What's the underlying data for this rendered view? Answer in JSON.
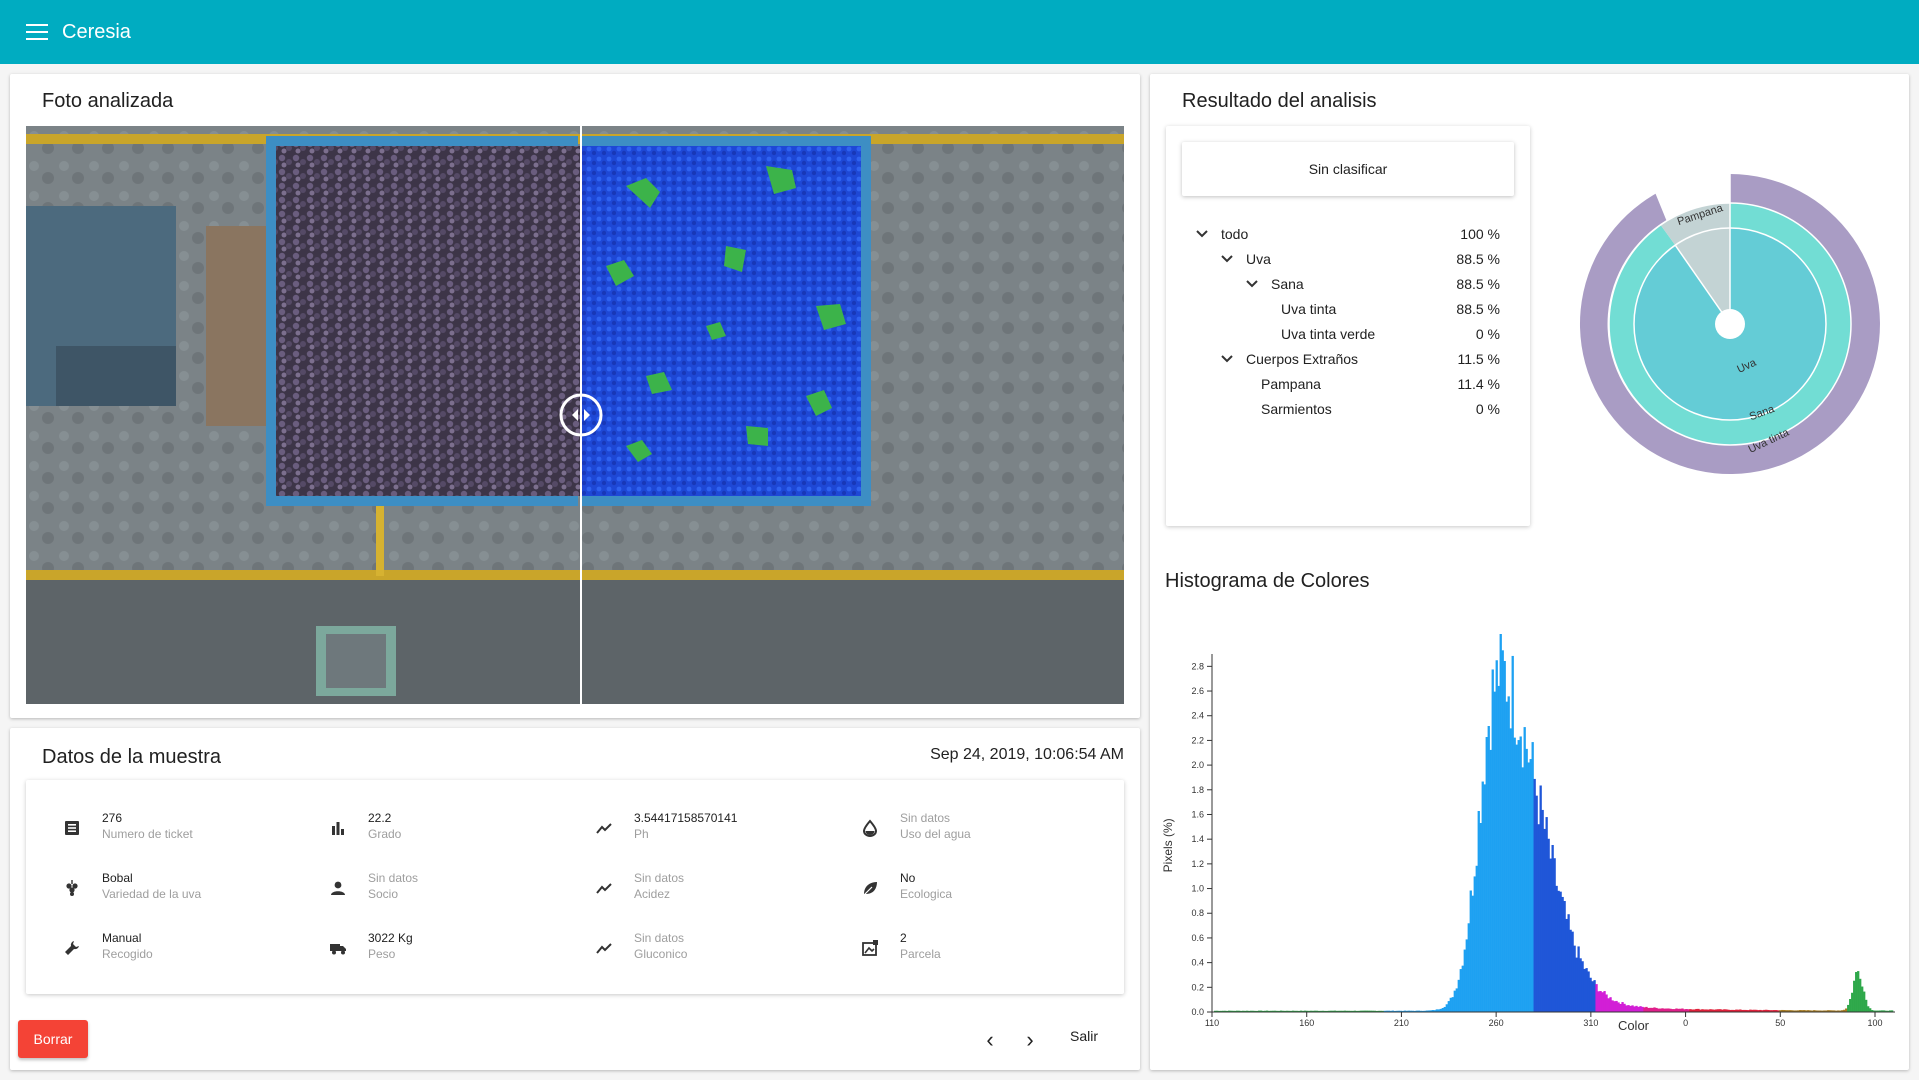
{
  "app": {
    "title": "Ceresia"
  },
  "photo": {
    "title": "Foto analizada"
  },
  "sample": {
    "title": "Datos de la muestra",
    "date": "Sep 24, 2019, 10:06:54 AM",
    "fields": [
      {
        "value": "276",
        "label": "Numero de ticket",
        "icon": "receipt-icon"
      },
      {
        "value": "22.2",
        "label": "Grado",
        "icon": "bar-chart-icon"
      },
      {
        "value": "3.54417158570141",
        "label": "Ph",
        "icon": "trending-icon"
      },
      {
        "value": "Sin datos",
        "label": "Uso del agua",
        "icon": "water-drop-icon"
      },
      {
        "value": "Bobal",
        "label": "Variedad de la uva",
        "icon": "grape-icon"
      },
      {
        "value": "Sin datos",
        "label": "Socio",
        "icon": "person-icon"
      },
      {
        "value": "Sin datos",
        "label": "Acidez",
        "icon": "trending-icon"
      },
      {
        "value": "No",
        "label": "Ecologica",
        "icon": "leaf-icon"
      },
      {
        "value": "Manual",
        "label": "Recogido",
        "icon": "wrench-icon"
      },
      {
        "value": "3022 Kg",
        "label": "Peso",
        "icon": "truck-icon"
      },
      {
        "value": "Sin datos",
        "label": "Gluconico",
        "icon": "trending-icon"
      },
      {
        "value": "2",
        "label": "Parcela",
        "icon": "parcel-icon"
      }
    ],
    "buttons": {
      "delete": "Borrar",
      "prev": "‹",
      "next": "›",
      "exit": "Salir"
    }
  },
  "result": {
    "title": "Resultado del analisis",
    "classify_button": "Sin clasificar",
    "tree": [
      {
        "name": "todo",
        "pct": "100 %"
      },
      {
        "name": "Uva",
        "pct": "88.5 %"
      },
      {
        "name": "Sana",
        "pct": "88.5 %"
      },
      {
        "name": "Uva tinta",
        "pct": "88.5 %"
      },
      {
        "name": "Uva tinta verde",
        "pct": "0 %"
      },
      {
        "name": "Cuerpos Extraños",
        "pct": "11.5 %"
      },
      {
        "name": "Pampana",
        "pct": "11.4 %"
      },
      {
        "name": "Sarmientos",
        "pct": "0 %"
      }
    ],
    "sunburst": {
      "labels": {
        "uva": "Uva",
        "sana": "Sana",
        "uva_tinta": "Uva tinta",
        "pampana": "Pampana"
      },
      "colors": {
        "uva": "#64ccd6",
        "sana": "#72ddd4",
        "uva_tinta": "#a99cc4",
        "pampana": "#c3d3d4"
      }
    }
  },
  "histogram": {
    "title": "Histograma de Colores"
  },
  "chart_data": {
    "type": "bar",
    "xlabel": "Color",
    "ylabel": "Pixels (%)",
    "ylim": [
      0,
      2.9
    ],
    "yticks": [
      "0.0",
      "0.2",
      "0.4",
      "0.6",
      "0.8",
      "1.0",
      "1.2",
      "1.4",
      "1.6",
      "1.8",
      "2.0",
      "2.2",
      "2.4",
      "2.6",
      "2.8"
    ],
    "xticks": [
      "110",
      "160",
      "210",
      "260",
      "310",
      "0",
      "50",
      "100"
    ],
    "peaks": [
      {
        "x": 260,
        "y": 2.65
      },
      {
        "x": 100,
        "y": 0.32
      }
    ]
  }
}
